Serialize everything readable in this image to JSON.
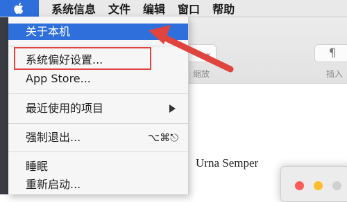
{
  "menubar": {
    "apple_icon": "apple-icon",
    "items": [
      "系统信息",
      "文件",
      "编辑",
      "窗口",
      "帮助"
    ]
  },
  "apple_menu": {
    "items": [
      {
        "label": "关于本机",
        "highlighted": true
      },
      {
        "label": "系统偏好设置..."
      },
      {
        "label": "App Store..."
      },
      {
        "label": "最近使用的项目",
        "submenu": true
      },
      {
        "label": "强制退出...",
        "shortcut": "⌥⌘⎋"
      },
      {
        "label": "睡眠"
      },
      {
        "label": "重新启动..."
      }
    ]
  },
  "background": {
    "toolbar_labels": [
      "缩放",
      "插入"
    ],
    "paragraph_icon": "¶",
    "doc_text": "Urna Semper"
  },
  "colors": {
    "menu_highlight": "#2f6fdc",
    "annotation_red": "#e0443f"
  }
}
